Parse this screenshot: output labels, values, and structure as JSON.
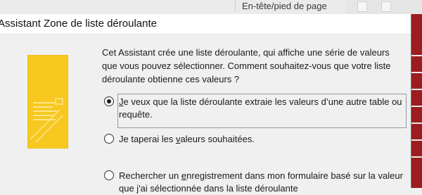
{
  "ribbon": {
    "tab_label": "En-tête/pied de page"
  },
  "dialog": {
    "title": "Assistant Zone de liste déroulante",
    "intro": "Cet Assistant crée une liste déroulante, qui affiche une série de valeurs que vous pouvez sélectionner. Comment souhaitez-vous que votre liste déroulante obtienne ces valeurs ?",
    "options": [
      {
        "label_prefix": "",
        "access_key": "J",
        "label_suffix": "e veux que la liste déroulante extraie les valeurs d’une autre table ou requête.",
        "checked": true
      },
      {
        "label_prefix": "Je taperai les ",
        "access_key": "v",
        "label_suffix": "aleurs souhaitées.",
        "checked": false
      },
      {
        "label_prefix": "Rechercher un ",
        "access_key": "e",
        "label_suffix": "nregistrement dans mon formulaire basé sur la valeur que j'ai sélectionnée dans la liste déroulante",
        "checked": false
      }
    ]
  },
  "colors": {
    "illustration_yellow": "#f7c820",
    "access_red": "#9b1d20"
  },
  "icons": {
    "illustration": "combo-box-list-illustration"
  }
}
